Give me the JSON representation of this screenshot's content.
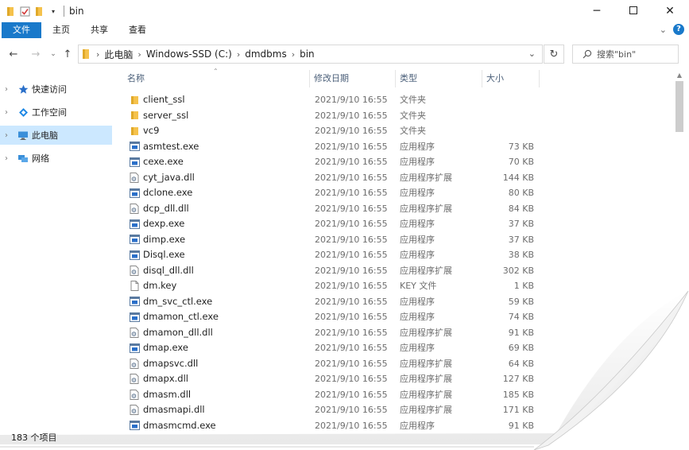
{
  "window": {
    "title": "bin"
  },
  "ribbon": {
    "tabs": [
      "文件",
      "主页",
      "共享",
      "查看"
    ]
  },
  "address": {
    "crumbs": [
      "此电脑",
      "Windows-SSD (C:)",
      "dmdbms",
      "bin"
    ],
    "search_placeholder": "搜索\"bin\""
  },
  "sidebar": {
    "items": [
      {
        "label": "快速访问",
        "icon": "star-icon",
        "selected": false
      },
      {
        "label": "工作空间",
        "icon": "workspace-icon",
        "selected": false
      },
      {
        "label": "此电脑",
        "icon": "computer-icon",
        "selected": true
      },
      {
        "label": "网络",
        "icon": "network-icon",
        "selected": false
      }
    ]
  },
  "columns": {
    "name": "名称",
    "date": "修改日期",
    "type": "类型",
    "size": "大小"
  },
  "files": [
    {
      "name": "client_ssl",
      "date": "2021/9/10 16:55",
      "type": "文件夹",
      "size": "",
      "icon": "folder-icon"
    },
    {
      "name": "server_ssl",
      "date": "2021/9/10 16:55",
      "type": "文件夹",
      "size": "",
      "icon": "folder-icon"
    },
    {
      "name": "vc9",
      "date": "2021/9/10 16:55",
      "type": "文件夹",
      "size": "",
      "icon": "folder-icon"
    },
    {
      "name": "asmtest.exe",
      "date": "2021/9/10 16:55",
      "type": "应用程序",
      "size": "73 KB",
      "icon": "exe-icon"
    },
    {
      "name": "cexe.exe",
      "date": "2021/9/10 16:55",
      "type": "应用程序",
      "size": "70 KB",
      "icon": "exe-icon"
    },
    {
      "name": "cyt_java.dll",
      "date": "2021/9/10 16:55",
      "type": "应用程序扩展",
      "size": "144 KB",
      "icon": "dll-icon"
    },
    {
      "name": "dclone.exe",
      "date": "2021/9/10 16:55",
      "type": "应用程序",
      "size": "80 KB",
      "icon": "exe-icon"
    },
    {
      "name": "dcp_dll.dll",
      "date": "2021/9/10 16:55",
      "type": "应用程序扩展",
      "size": "84 KB",
      "icon": "dll-icon"
    },
    {
      "name": "dexp.exe",
      "date": "2021/9/10 16:55",
      "type": "应用程序",
      "size": "37 KB",
      "icon": "exe-icon"
    },
    {
      "name": "dimp.exe",
      "date": "2021/9/10 16:55",
      "type": "应用程序",
      "size": "37 KB",
      "icon": "exe-icon"
    },
    {
      "name": "Disql.exe",
      "date": "2021/9/10 16:55",
      "type": "应用程序",
      "size": "38 KB",
      "icon": "exe-icon"
    },
    {
      "name": "disql_dll.dll",
      "date": "2021/9/10 16:55",
      "type": "应用程序扩展",
      "size": "302 KB",
      "icon": "dll-icon"
    },
    {
      "name": "dm.key",
      "date": "2021/9/10 16:55",
      "type": "KEY 文件",
      "size": "1 KB",
      "icon": "file-icon"
    },
    {
      "name": "dm_svc_ctl.exe",
      "date": "2021/9/10 16:55",
      "type": "应用程序",
      "size": "59 KB",
      "icon": "exe-icon"
    },
    {
      "name": "dmamon_ctl.exe",
      "date": "2021/9/10 16:55",
      "type": "应用程序",
      "size": "74 KB",
      "icon": "exe-icon"
    },
    {
      "name": "dmamon_dll.dll",
      "date": "2021/9/10 16:55",
      "type": "应用程序扩展",
      "size": "91 KB",
      "icon": "dll-icon"
    },
    {
      "name": "dmap.exe",
      "date": "2021/9/10 16:55",
      "type": "应用程序",
      "size": "69 KB",
      "icon": "exe-icon"
    },
    {
      "name": "dmapsvc.dll",
      "date": "2021/9/10 16:55",
      "type": "应用程序扩展",
      "size": "64 KB",
      "icon": "dll-icon"
    },
    {
      "name": "dmapx.dll",
      "date": "2021/9/10 16:55",
      "type": "应用程序扩展",
      "size": "127 KB",
      "icon": "dll-icon"
    },
    {
      "name": "dmasm.dll",
      "date": "2021/9/10 16:55",
      "type": "应用程序扩展",
      "size": "185 KB",
      "icon": "dll-icon"
    },
    {
      "name": "dmasmapi.dll",
      "date": "2021/9/10 16:55",
      "type": "应用程序扩展",
      "size": "171 KB",
      "icon": "dll-icon"
    },
    {
      "name": "dmasmcmd.exe",
      "date": "2021/9/10 16:55",
      "type": "应用程序",
      "size": "91 KB",
      "icon": "exe-icon"
    }
  ],
  "status": {
    "item_count": "183 个项目"
  },
  "colors": {
    "accent": "#1979ca",
    "selection": "#cce8ff",
    "folder": "#f5c24c"
  }
}
